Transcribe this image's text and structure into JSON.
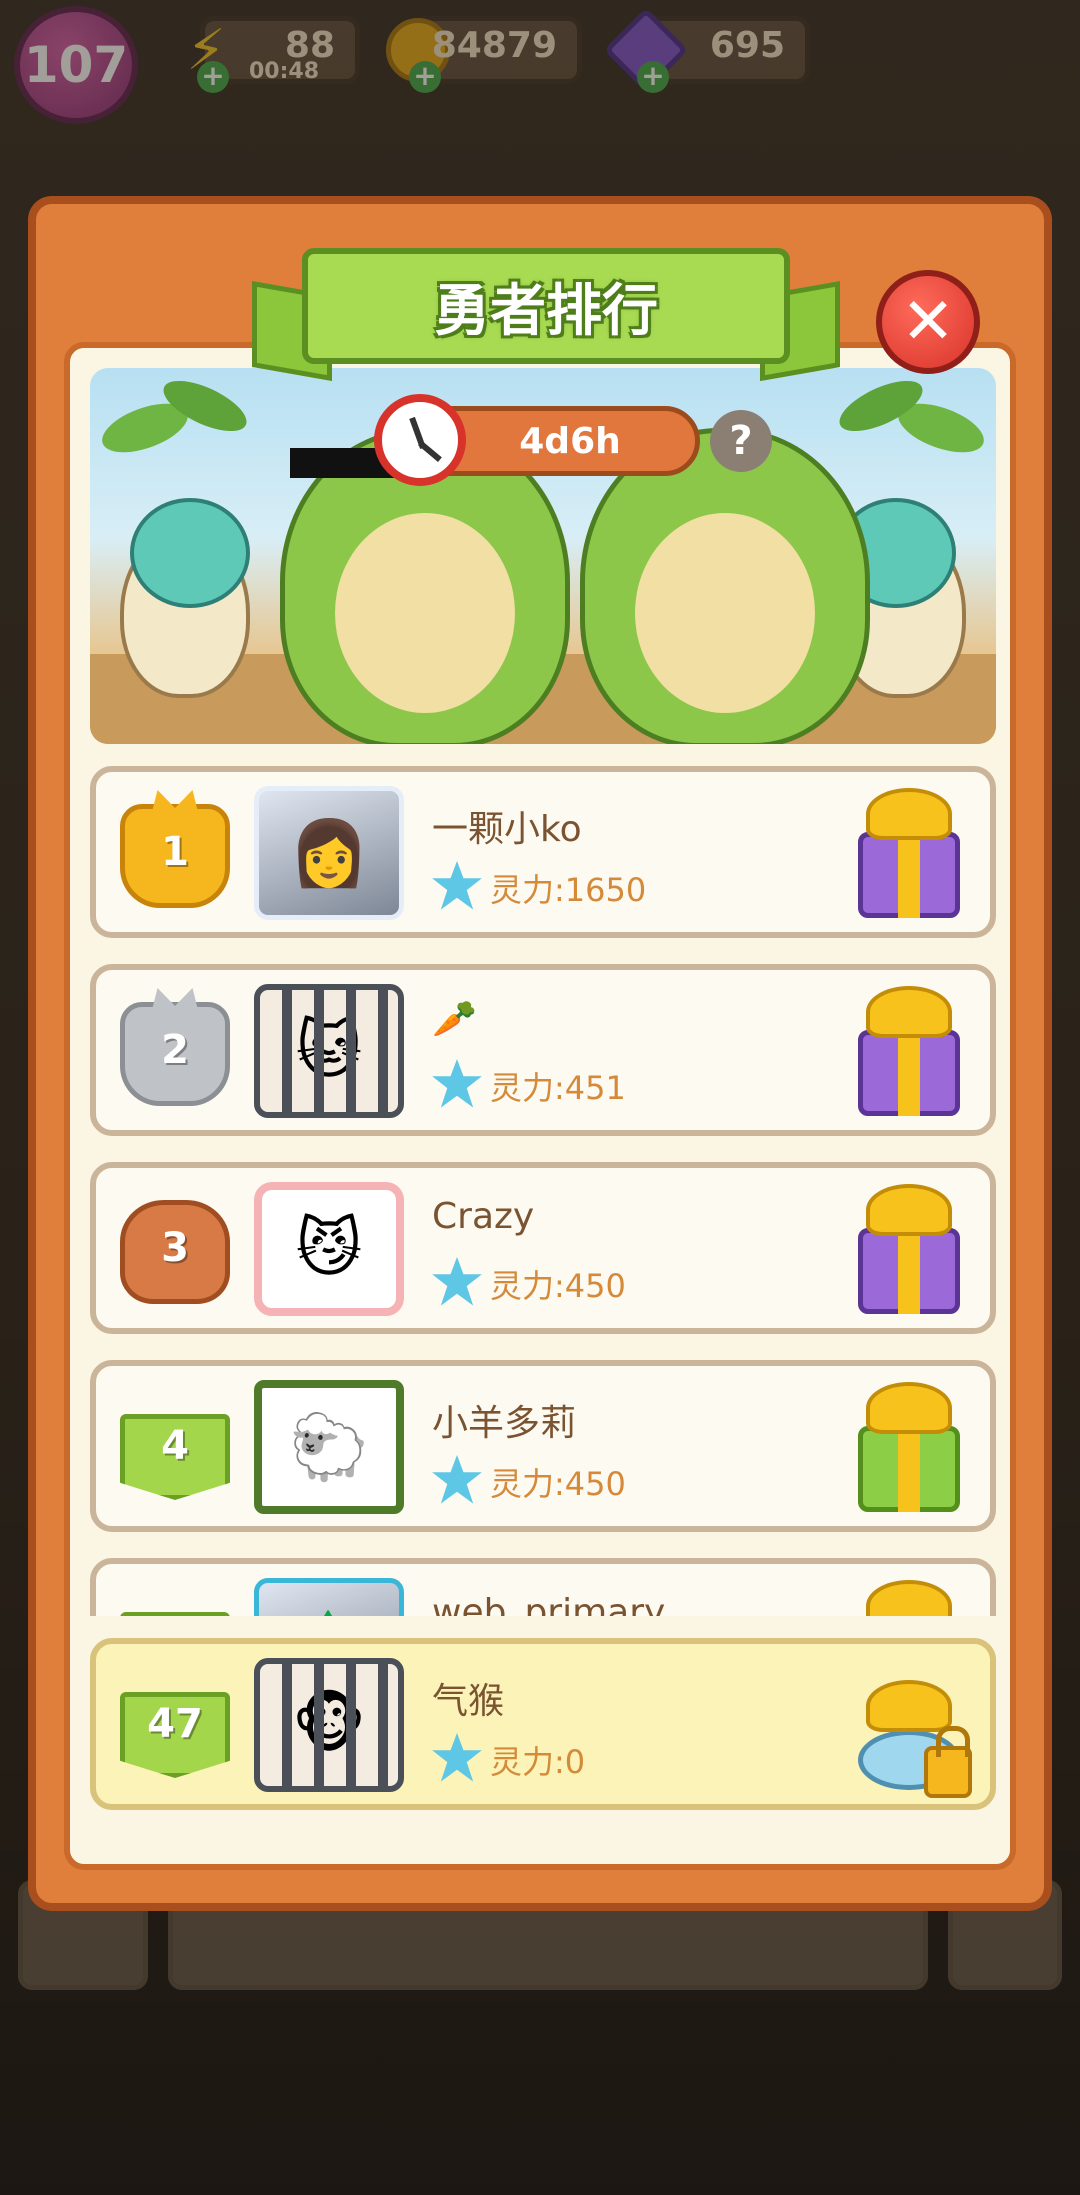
{
  "hud": {
    "level": "107",
    "energy": {
      "value": "88",
      "timer": "00:48",
      "icon": "lightning-icon"
    },
    "coins": {
      "value": "84879",
      "icon": "coin-icon"
    },
    "gems": {
      "value": "695",
      "icon": "gem-icon"
    }
  },
  "modal": {
    "title": "勇者排行",
    "timer": "4d6h",
    "help_label": "?",
    "close_label": "✕"
  },
  "rankings": [
    {
      "rank": "1",
      "name": "一颗小ko",
      "spirit": "灵力:1650",
      "avatar": "photo",
      "medal": "gold",
      "gift": "purple"
    },
    {
      "rank": "2",
      "name": "🥕",
      "spirit": "灵力:451",
      "avatar": "cage",
      "medal": "silver",
      "gift": "purple"
    },
    {
      "rank": "3",
      "name": "Crazy",
      "spirit": "灵力:450",
      "avatar": "cat",
      "medal": "bronze",
      "gift": "purple"
    },
    {
      "rank": "4",
      "name": "小羊多莉",
      "spirit": "灵力:450",
      "avatar": "sheep",
      "medal": "green",
      "gift": "green"
    },
    {
      "rank": "",
      "name": "web_primary",
      "spirit": "",
      "avatar": "photo",
      "medal": "green",
      "gift": "green"
    }
  ],
  "my_rank": {
    "rank": "47",
    "name": "气猴",
    "spirit": "灵力:0",
    "gift": "locked"
  },
  "colors": {
    "accent_orange": "#e07f3c",
    "ribbon_green": "#a8da52",
    "close_red": "#d8332a",
    "spirit_text": "#d58a3a"
  }
}
